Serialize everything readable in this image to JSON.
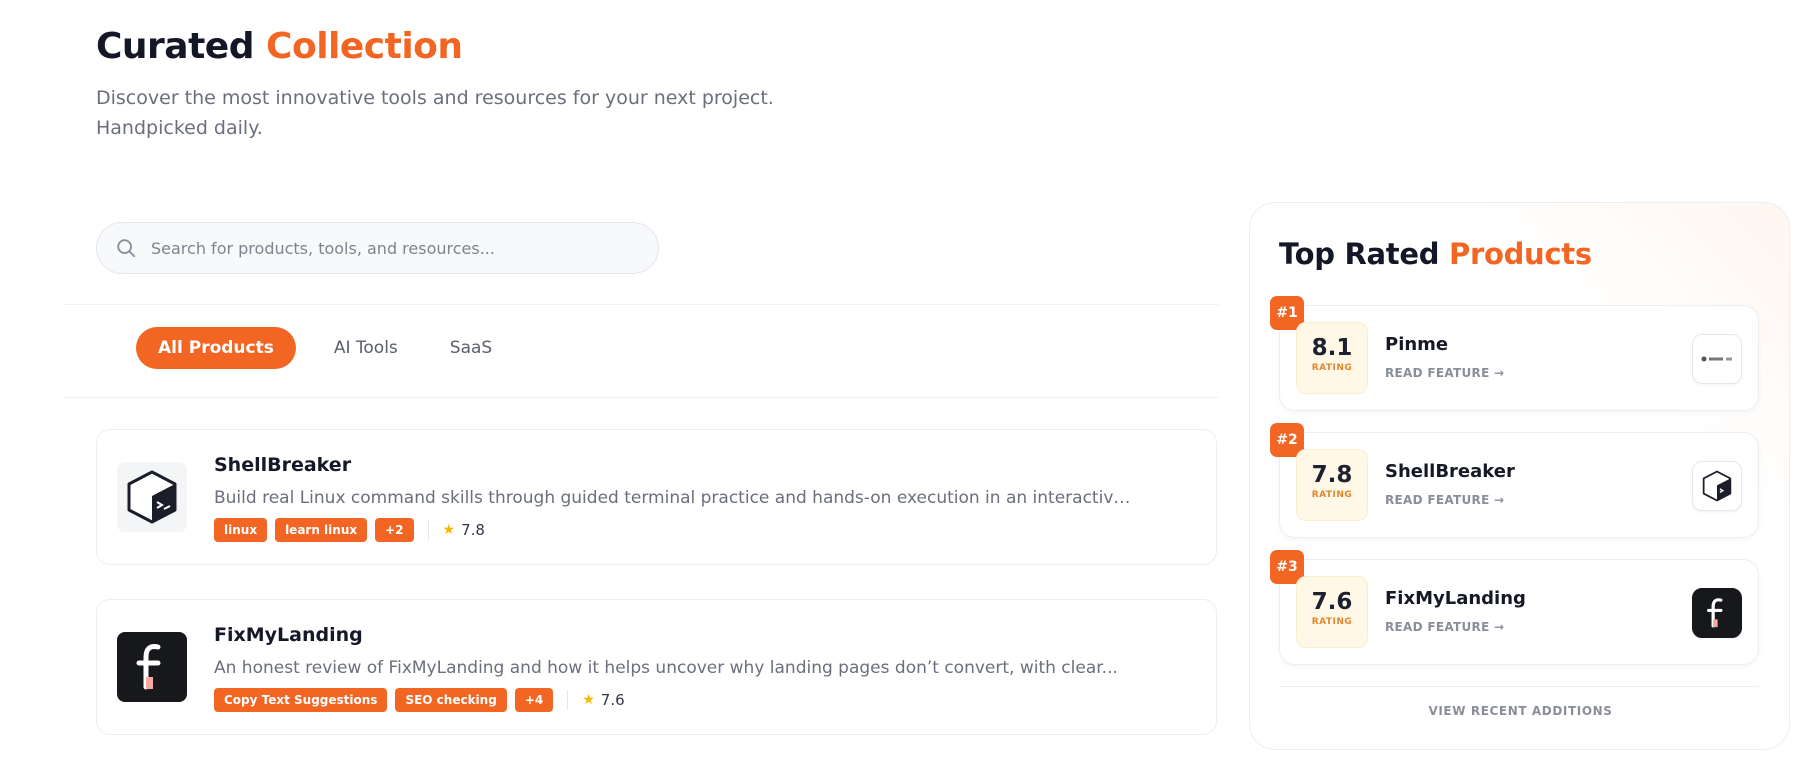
{
  "header": {
    "title_part1": "Curated",
    "title_part2": "Collection",
    "subtitle_line1": "Discover the most innovative tools and resources for your next project.",
    "subtitle_line2": "Handpicked daily."
  },
  "search": {
    "placeholder": "Search for products, tools, and resources...",
    "icon": "search-icon"
  },
  "filters": {
    "tabs": [
      "All Products",
      "AI Tools",
      "SaaS"
    ],
    "active": "All Products"
  },
  "products": [
    {
      "name": "ShellBreaker",
      "description": "Build real Linux command skills through guided terminal practice and hands-on execution in an interactive...",
      "tags": [
        "linux",
        "learn linux",
        "+2"
      ],
      "rating": "7.8",
      "logo": "terminal-cube-icon"
    },
    {
      "name": "FixMyLanding",
      "description": "An honest review of FixMyLanding and how it helps uncover why landing pages don’t convert, with clear...",
      "tags": [
        "Copy Text Suggestions",
        "SEO checking",
        "+4"
      ],
      "rating": "7.6",
      "logo": "fixmylanding-f-icon"
    }
  ],
  "sidebar": {
    "title_part1": "Top Rated",
    "title_part2": "Products",
    "rating_label": "RATING",
    "read_feature": "READ FEATURE →",
    "items": [
      {
        "rank": "#1",
        "score": "8.1",
        "name": "Pinme",
        "logo": "pinme-logo-icon"
      },
      {
        "rank": "#2",
        "score": "7.8",
        "name": "ShellBreaker",
        "logo": "terminal-cube-icon"
      },
      {
        "rank": "#3",
        "score": "7.6",
        "name": "FixMyLanding",
        "logo": "fixmylanding-f-icon"
      }
    ],
    "footer": "VIEW RECENT ADDITIONS"
  },
  "colors": {
    "accent": "#f26522",
    "text_dark": "#141826",
    "text_muted": "#6b6f7b",
    "star": "#f6b800"
  }
}
